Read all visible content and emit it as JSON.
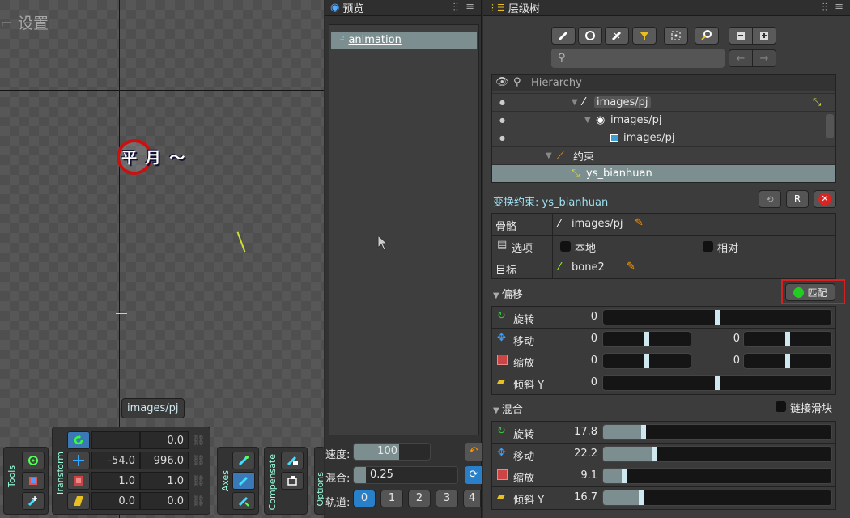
{
  "viewport": {
    "back_label": "设置",
    "sprite_text": "平 月 ～",
    "bone_tooltip": "images/pj"
  },
  "tools": {
    "label": "Tools"
  },
  "transform": {
    "label": "Transform",
    "rows": [
      {
        "a": "",
        "b": "0.0"
      },
      {
        "a": "-54.0",
        "b": "996.0"
      },
      {
        "a": "1.0",
        "b": "1.0"
      },
      {
        "a": "0.0",
        "b": "0.0"
      }
    ]
  },
  "axes": {
    "label": "Axes"
  },
  "compensate": {
    "label": "Compensate"
  },
  "options": {
    "label": "Options"
  },
  "preview": {
    "tab": "预览",
    "item": "animation",
    "speed_label": "速度:",
    "speed_value": "100",
    "speed_pct": 0.6,
    "mix_label": "混合:",
    "mix_value": "0.25",
    "mix_pct": 0.12,
    "track_label": "轨道:",
    "tracks": [
      "0",
      "1",
      "2",
      "3",
      "4"
    ],
    "active_track": "0"
  },
  "hierarchy": {
    "tab": "层级树",
    "column": "Hierarchy",
    "tree": [
      {
        "label": "images/pj",
        "icon": "bone-icon"
      },
      {
        "label": "images/pj",
        "icon": "slot-icon"
      },
      {
        "label": "images/pj",
        "icon": "region-icon"
      },
      {
        "label": "约束",
        "icon": "constraint-icon"
      },
      {
        "label": "ys_bianhuan",
        "icon": "transform-constraint-icon"
      }
    ],
    "title": "变换约束: ys_bianhuan",
    "bone_label": "骨骼",
    "bone_value": "images/pj",
    "options_label": "选项",
    "local_label": "本地",
    "relative_label": "相对",
    "target_label": "目标",
    "target_value": "bone2",
    "offset_header": "偏移",
    "match_button": "匹配",
    "offset": [
      {
        "label": "旋转",
        "v1": "0",
        "p1": 0.5
      },
      {
        "label": "移动",
        "v1": "0",
        "p1": 0.5,
        "v2": "0",
        "p2": 0.5
      },
      {
        "label": "缩放",
        "v1": "0",
        "p1": 0.5,
        "v2": "0",
        "p2": 0.5
      },
      {
        "label": "倾斜 Y",
        "v1": "0",
        "p1": 0.5
      }
    ],
    "mix_header": "混合",
    "link_label": "链接滑块",
    "mix": [
      {
        "label": "旋转",
        "value": "17.8",
        "pct": 0.178
      },
      {
        "label": "移动",
        "value": "22.2",
        "pct": 0.222
      },
      {
        "label": "缩放",
        "value": "9.1",
        "pct": 0.091
      },
      {
        "label": "倾斜 Y",
        "value": "16.7",
        "pct": 0.167
      }
    ],
    "colors": {
      "match_highlight": "#d42020",
      "rotate": "#3fbf3f",
      "translate": "#3aa0ff",
      "scale": "#d04a4a",
      "shear": "#e8c020"
    }
  }
}
